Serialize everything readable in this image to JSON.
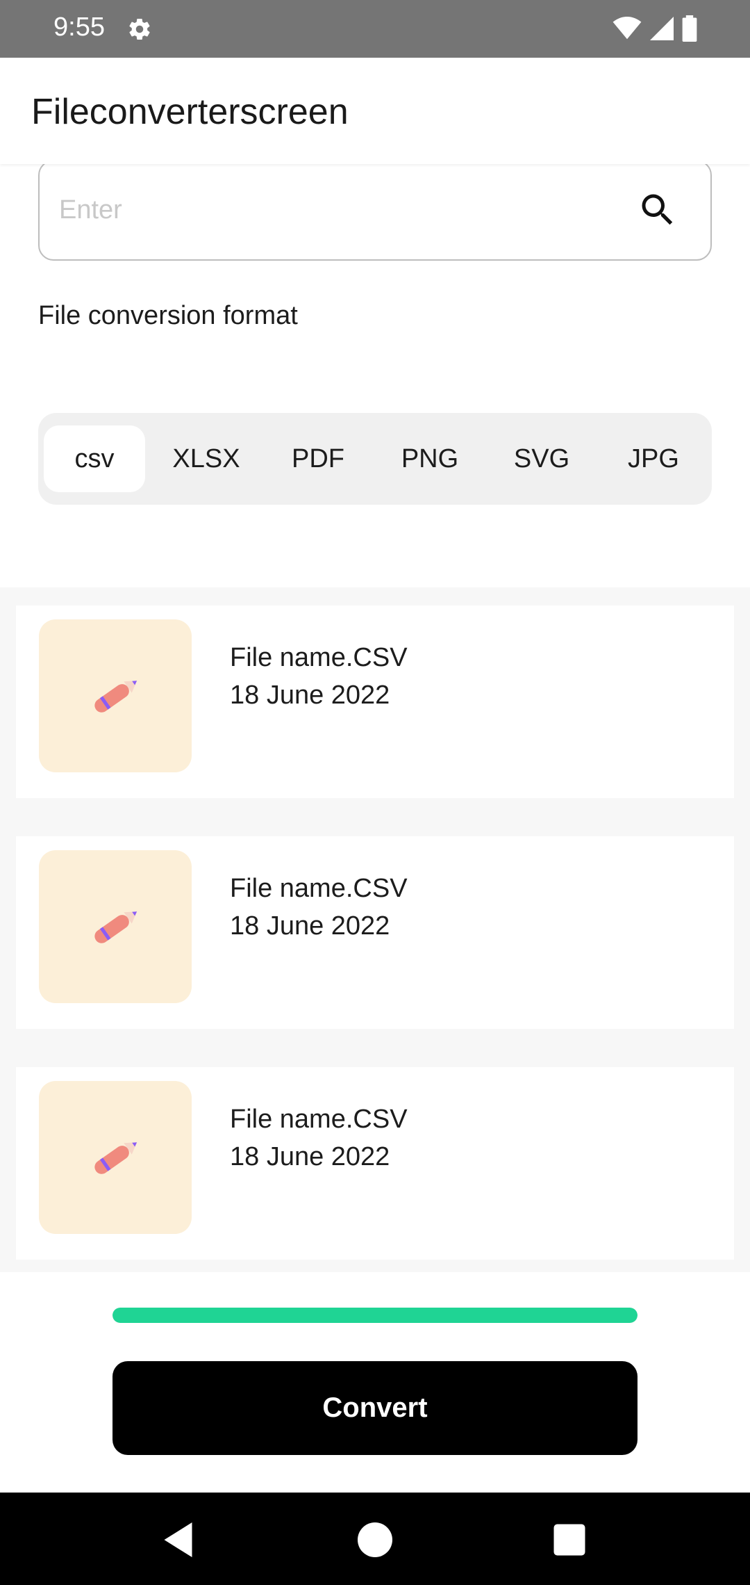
{
  "status_bar": {
    "time": "9:55",
    "icons": [
      "gear-icon",
      "wifi-icon",
      "signal-icon",
      "battery-icon"
    ]
  },
  "app_bar": {
    "title": "Fileconverterscreen"
  },
  "search": {
    "placeholder": "Enter",
    "value": "",
    "icon": "search-icon"
  },
  "section_label": "File conversion format",
  "formats": {
    "selected": "csv",
    "options": [
      "csv",
      "XLSX",
      "PDF",
      "PNG",
      "SVG",
      "JPG"
    ]
  },
  "files": [
    {
      "name": "File name.CSV",
      "date": "18 June 2022",
      "icon": "pencil-icon"
    },
    {
      "name": "File name.CSV",
      "date": "18 June 2022",
      "icon": "pencil-icon"
    },
    {
      "name": "File name.CSV",
      "date": "18 June 2022",
      "icon": "pencil-icon"
    }
  ],
  "progress": {
    "percent": 100,
    "color": "#1fd494"
  },
  "convert_button": {
    "label": "Convert"
  },
  "colors": {
    "status_bar": "#757575",
    "thumb_bg": "#fcefd8",
    "button_bg": "#000000",
    "accent": "#1fd494"
  }
}
